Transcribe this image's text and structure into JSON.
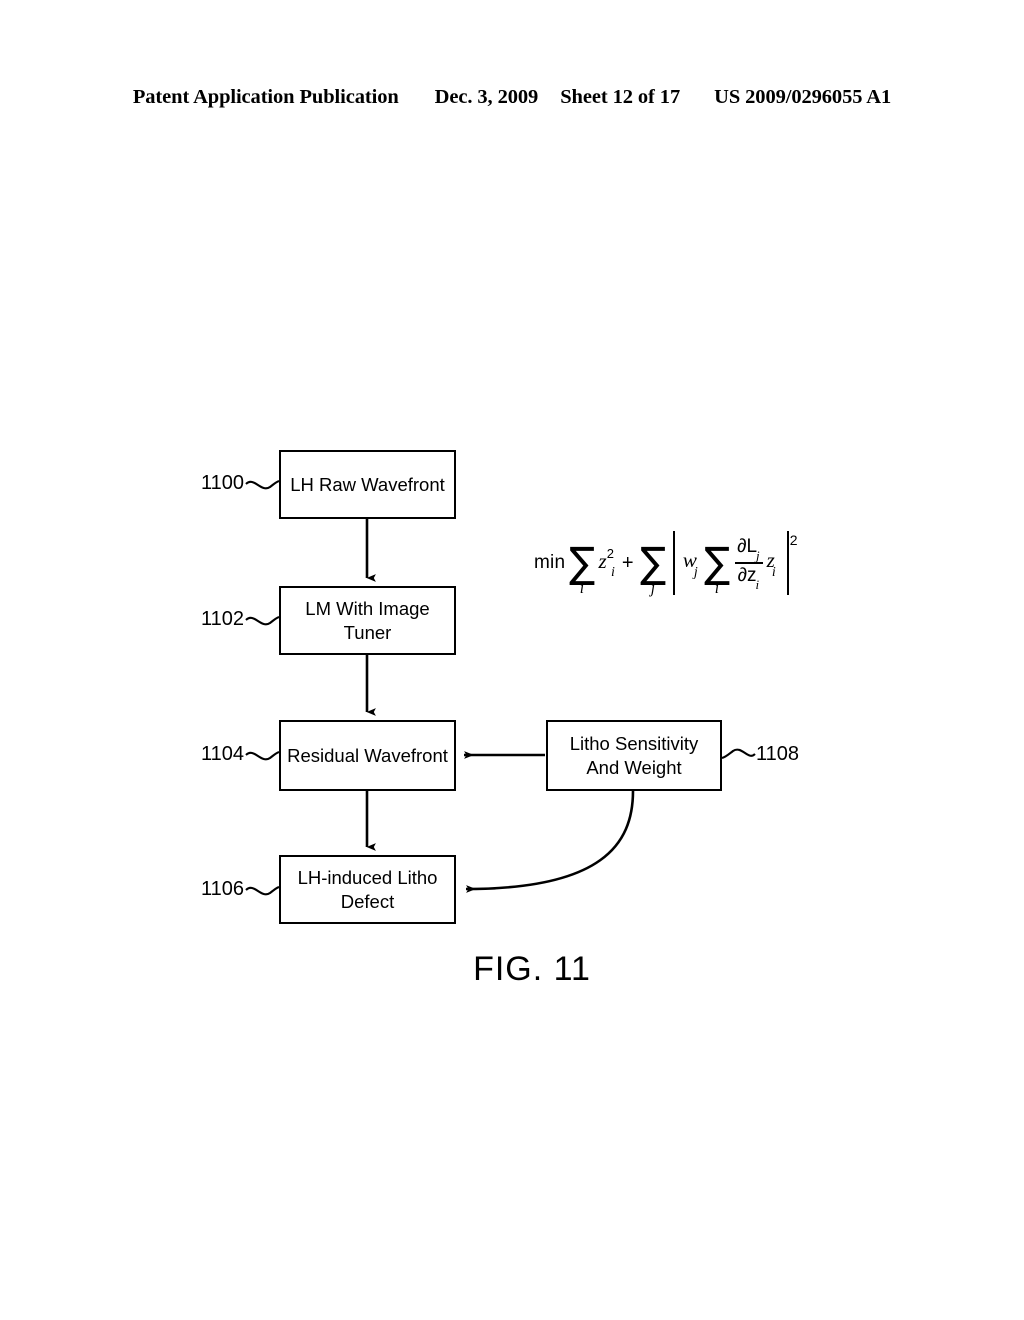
{
  "header": {
    "publication": "Patent Application Publication",
    "date": "Dec. 3, 2009",
    "sheet": "Sheet 12 of 17",
    "number": "US 2009/0296055 A1"
  },
  "figure": {
    "caption": "FIG. 11",
    "boxes": [
      {
        "ref": "1100",
        "label": "LH Raw Wavefront"
      },
      {
        "ref": "1102",
        "label": "LM With Image Tuner"
      },
      {
        "ref": "1104",
        "label": "Residual Wavefront"
      },
      {
        "ref": "1106",
        "label": "LH-induced Litho Defect"
      },
      {
        "ref": "1108",
        "label": "Litho Sensitivity And Weight"
      }
    ],
    "equation": {
      "plain": "min Σi z²i + Σj | wj Σi ∂Lj/∂zi zi |²",
      "min": "min",
      "sum1": "∑",
      "sum1_sub": "i",
      "z_term": "z",
      "z_sup": "2",
      "z_sub": "i",
      "plus": "+",
      "sum2": "∑",
      "sum2_sub": "j",
      "bar": "|",
      "w": "w",
      "w_sub": "j",
      "sum3": "∑",
      "sum3_sub": "i",
      "frac_num": "∂L",
      "frac_num_sub": "j",
      "frac_den": "∂z",
      "frac_den_sub": "i",
      "tail_z": "z",
      "tail_z_sub": "i",
      "outer_sup": "2"
    },
    "colors": {
      "ink": "#000000",
      "paper": "#ffffff"
    }
  }
}
